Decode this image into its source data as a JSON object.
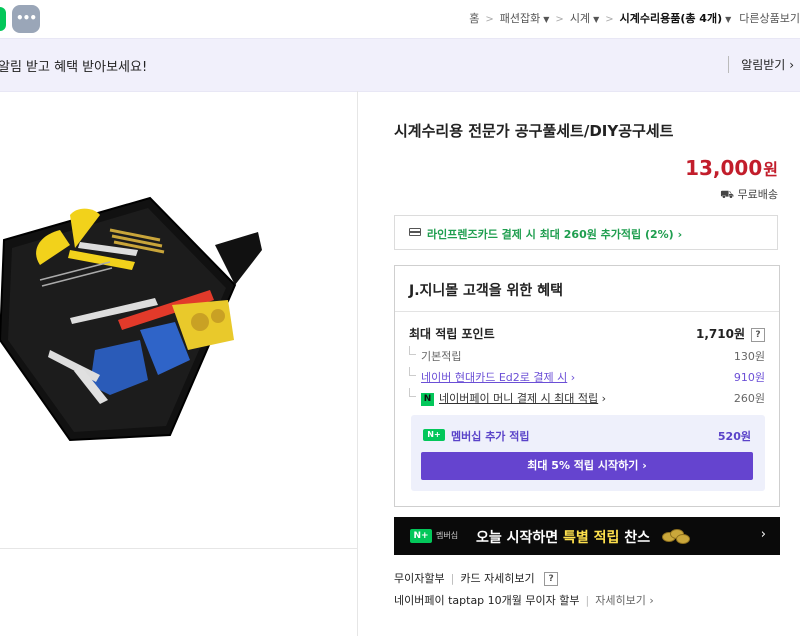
{
  "topbar": {
    "more_label": "•••",
    "breadcrumb": {
      "home": "홈",
      "level1": "패션잡화",
      "level2": "시계",
      "current": "시계수리용품(총 4개)",
      "other": "다른상품보기"
    }
  },
  "notice": {
    "text": "알림 받고 혜택 받아보세요!",
    "button": "알림받기"
  },
  "product": {
    "title": "시계수리용 전문가 공구풀세트/DIY공구세트",
    "price": "13,000",
    "price_unit": "원",
    "shipping": "무료배송"
  },
  "card_promo": {
    "text": "라인프렌즈카드 결제 시 최대 260원 추가적립 (2%)"
  },
  "benefits": {
    "title": "J.지니몰 고객을 위한 혜택",
    "max_points_label": "최대 적립 포인트",
    "max_points_value": "1,710원",
    "qmark": "?",
    "basic_label": "기본적립",
    "basic_value": "130원",
    "hyundai_label": "네이버 현대카드 Ed2로 결제 시",
    "hyundai_value": "910원",
    "npay_badge": "N",
    "npay_label": "네이버페이 머니 결제 시 최대 적립",
    "npay_value": "260원",
    "membership_tag": "N+",
    "membership_label": "멤버십 추가 적립",
    "membership_value": "520원",
    "membership_button": "최대 5% 적립 시작하기"
  },
  "banner": {
    "tag": "N+",
    "membership": "멤버십",
    "text_prefix": "오늘 시작하면 ",
    "text_highlight": "특별 적립",
    "text_suffix": " 찬스"
  },
  "installment": {
    "label": "무이자할부",
    "card_detail": "카드 자세히보기",
    "qmark": "?",
    "npay_text": "네이버페이 taptap 10개월 무이자 할부",
    "detail": "자세히보기"
  },
  "colors": {
    "price": "#c21d2b",
    "naver_green": "#03c75a",
    "membership_purple": "#6544cf",
    "promo_green": "#1f9e4f"
  }
}
